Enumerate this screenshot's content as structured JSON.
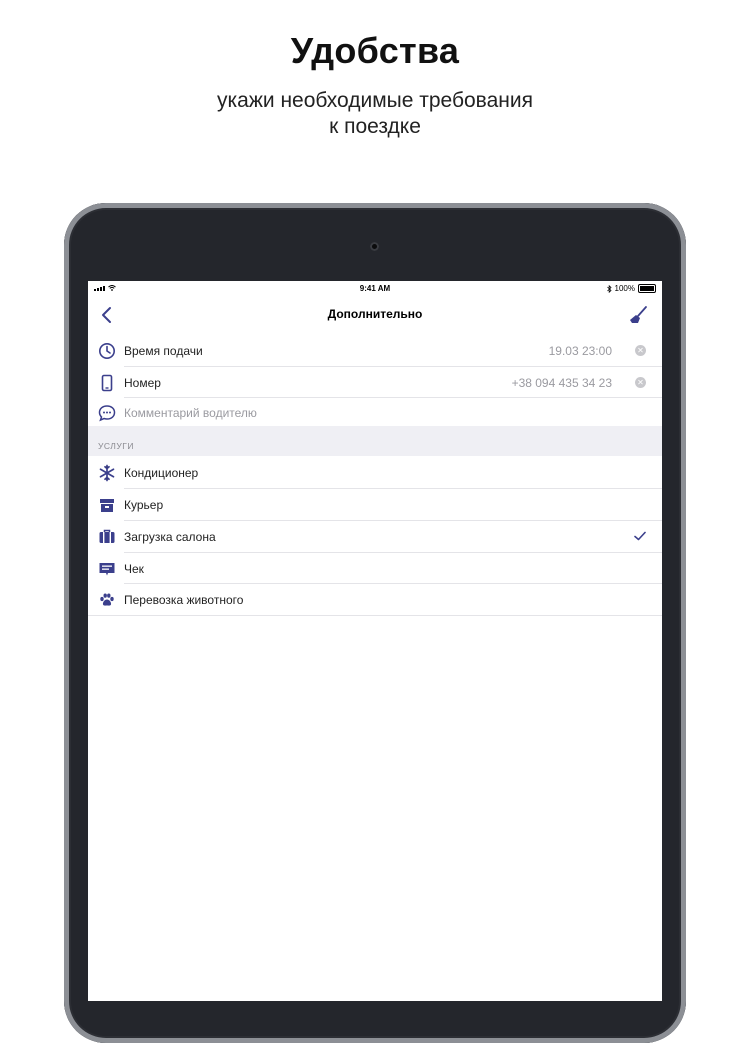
{
  "promo": {
    "title": "Удобства",
    "subtitle_line1": "укажи необходимые требования",
    "subtitle_line2": "к поездке"
  },
  "status_bar": {
    "time": "9:41 AM",
    "battery": "100%"
  },
  "nav": {
    "title": "Дополнительно",
    "back_icon": "chevron-left-icon",
    "action_icon": "broom-icon"
  },
  "details": [
    {
      "icon": "clock-icon",
      "label": "Время подачи",
      "value": "19.03  23:00",
      "clearable": true
    },
    {
      "icon": "phone-icon",
      "label": "Номер",
      "value": "+38 094 435 34 23",
      "clearable": true
    },
    {
      "icon": "chat-icon",
      "label": "Комментарий водителю",
      "placeholder": true
    }
  ],
  "services_header": "УСЛУГИ",
  "services": [
    {
      "icon": "snowflake-icon",
      "label": "Кондиционер",
      "checked": false
    },
    {
      "icon": "box-icon",
      "label": "Курьер",
      "checked": false
    },
    {
      "icon": "luggage-icon",
      "label": "Загрузка салона",
      "checked": true
    },
    {
      "icon": "receipt-icon",
      "label": "Чек",
      "checked": false
    },
    {
      "icon": "paw-icon",
      "label": "Перевозка животного",
      "checked": false
    }
  ],
  "colors": {
    "accent": "#3b3f8c",
    "device": "#24262c",
    "section_bg": "#efeff4"
  }
}
